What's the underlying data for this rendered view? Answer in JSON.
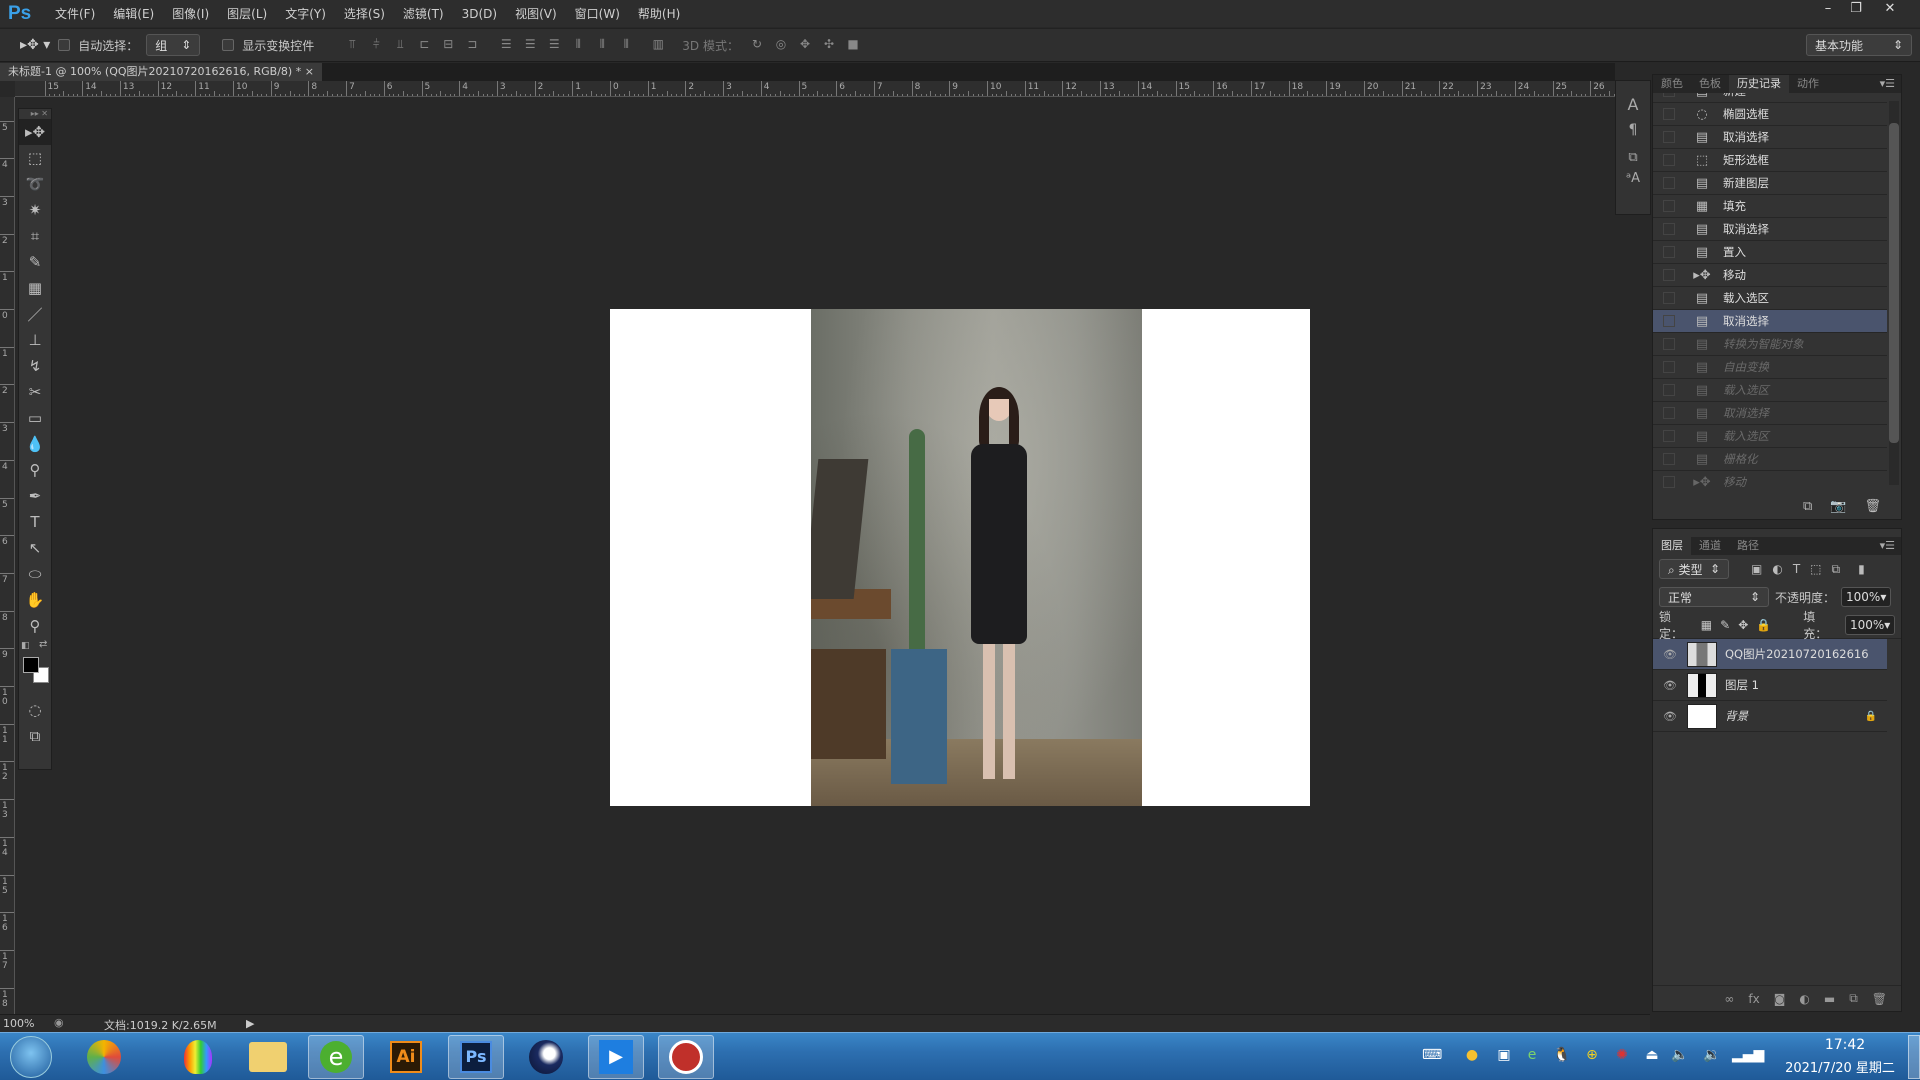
{
  "app": {
    "logo": "Ps",
    "menu": [
      "文件(F)",
      "编辑(E)",
      "图像(I)",
      "图层(L)",
      "文字(Y)",
      "选择(S)",
      "滤镜(T)",
      "3D(D)",
      "视图(V)",
      "窗口(W)",
      "帮助(H)"
    ],
    "window_buttons": [
      "–",
      "❐",
      "✕"
    ]
  },
  "options": {
    "auto_select_label": "自动选择：",
    "auto_select_value": "组",
    "show_transform_label": "显示变换控件",
    "mode_3d_label": "3D 模式：",
    "workspace": "基本功能"
  },
  "document": {
    "tab_title": "未标题-1 @ 100% (QQ图片20210720162616, RGB/8) *",
    "close": "×"
  },
  "rulers": {
    "horizontal": [
      "15",
      "14",
      "13",
      "12",
      "11",
      "10",
      "9",
      "8",
      "7",
      "6",
      "5",
      "4",
      "3",
      "2",
      "1",
      "0",
      "1",
      "2",
      "3",
      "4",
      "5",
      "6",
      "7",
      "8",
      "9",
      "10",
      "11",
      "12",
      "13",
      "14",
      "15",
      "16",
      "17",
      "18",
      "19",
      "20",
      "21",
      "22",
      "23",
      "24",
      "25",
      "26"
    ],
    "vertical": [
      "5",
      "4",
      "3",
      "2",
      "1",
      "0",
      "1",
      "2",
      "3",
      "4",
      "5",
      "6",
      "7",
      "8",
      "9",
      "10",
      "11",
      "12",
      "13",
      "14",
      "15",
      "16",
      "17",
      "18"
    ]
  },
  "history_panel": {
    "tabs": [
      "颜色",
      "色板",
      "历史记录",
      "动作"
    ],
    "active_tab": "历史记录",
    "items": [
      {
        "label": "新建",
        "icon": "document-icon",
        "state": "normal"
      },
      {
        "label": "椭圆选框",
        "icon": "ellipse-marquee-icon",
        "state": "normal"
      },
      {
        "label": "取消选择",
        "icon": "document-icon",
        "state": "normal"
      },
      {
        "label": "矩形选框",
        "icon": "rect-marquee-icon",
        "state": "normal"
      },
      {
        "label": "新建图层",
        "icon": "document-icon",
        "state": "normal"
      },
      {
        "label": "填充",
        "icon": "fill-icon",
        "state": "normal"
      },
      {
        "label": "取消选择",
        "icon": "document-icon",
        "state": "normal"
      },
      {
        "label": "置入",
        "icon": "document-icon",
        "state": "normal"
      },
      {
        "label": "移动",
        "icon": "move-icon",
        "state": "normal"
      },
      {
        "label": "载入选区",
        "icon": "document-icon",
        "state": "normal"
      },
      {
        "label": "取消选择",
        "icon": "document-icon",
        "state": "selected"
      },
      {
        "label": "转换为智能对象",
        "icon": "document-icon",
        "state": "undone"
      },
      {
        "label": "自由变换",
        "icon": "document-icon",
        "state": "undone"
      },
      {
        "label": "载入选区",
        "icon": "document-icon",
        "state": "undone"
      },
      {
        "label": "取消选择",
        "icon": "document-icon",
        "state": "undone"
      },
      {
        "label": "载入选区",
        "icon": "document-icon",
        "state": "undone"
      },
      {
        "label": "栅格化",
        "icon": "document-icon",
        "state": "undone"
      },
      {
        "label": "移动",
        "icon": "move-icon",
        "state": "undone"
      }
    ]
  },
  "layers_panel": {
    "tabs": [
      "图层",
      "通道",
      "路径"
    ],
    "active_tab": "图层",
    "filter": "类型",
    "blend_mode": "正常",
    "opacity_label": "不透明度：",
    "opacity": "100%",
    "lock_label": "锁定：",
    "fill_label": "填充：",
    "fill": "100%",
    "layers": [
      {
        "name": "QQ图片20210720162616",
        "selected": true,
        "visible": true
      },
      {
        "name": "图层 1",
        "selected": false,
        "visible": true
      },
      {
        "name": "背景",
        "selected": false,
        "visible": true,
        "locked": true
      }
    ]
  },
  "status": {
    "zoom": "100%",
    "doc_info": "文档:1019.2 K/2.65M"
  },
  "taskbar": {
    "time": "17:42",
    "date": "2021/7/20 星期二",
    "apps": [
      "360-icon",
      "balloon-icon",
      "explorer-icon",
      "browser-icon",
      "illustrator-icon",
      "photoshop-icon",
      "cinema4d-icon",
      "video-icon",
      "app-icon"
    ],
    "ai_label": "Ai",
    "ps_label": "Ps"
  },
  "colors": {
    "accent_selected": "#4a546d",
    "panel_bg": "#333333",
    "taskbar": "#2d6fb0",
    "ps_blue": "#3aa0e8"
  }
}
